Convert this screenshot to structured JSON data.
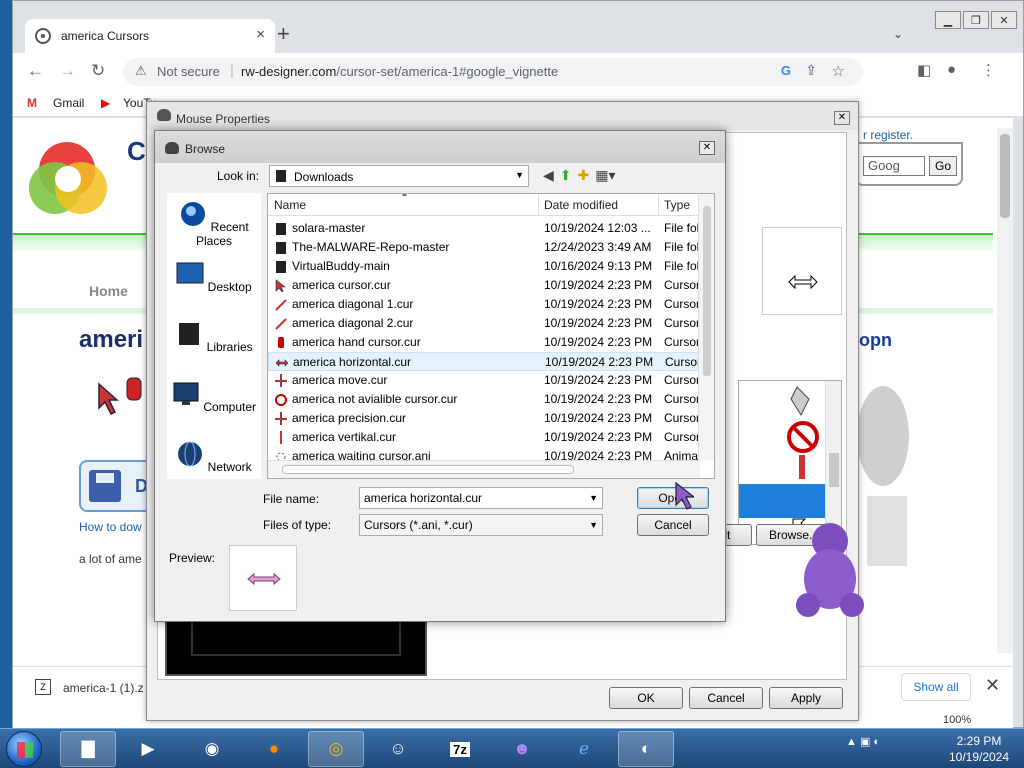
{
  "browser": {
    "tab_title": "america Cursors",
    "tab_close": "×",
    "new_tab": "+",
    "security": "Not secure",
    "url_host": "rw-designer.com",
    "url_path": "/cursor-set/america-1#google_vignette",
    "bookmarks": [
      "Gmail",
      "YouTu"
    ]
  },
  "webpage": {
    "site_initial": "C",
    "nav_home": "Home",
    "heading_partial": "ameri",
    "download_partial": "D",
    "howto_partial": "How to dow",
    "desc_partial": "a lot of ame",
    "register": "r register.",
    "search_placeholder": "Goog",
    "search_go": "Go",
    "right_partial": "opn",
    "download_file": "america-1 (1).z",
    "show_all": "Show all",
    "zoom": "100%"
  },
  "mouse_properties": {
    "title": "Mouse Properties",
    "use_default_partial": "ult",
    "browse_button": "Browse...",
    "ok": "OK",
    "cancel": "Cancel",
    "apply": "Apply"
  },
  "browse": {
    "title": "Browse",
    "look_in_label": "Look in:",
    "look_in_value": "Downloads",
    "places": [
      "Recent Places",
      "Desktop",
      "Libraries",
      "Computer",
      "Network"
    ],
    "columns": {
      "name": "Name",
      "date": "Date modified",
      "type": "Type"
    },
    "rows": [
      {
        "name": "solara-master",
        "date": "10/19/2024 12:03 ...",
        "type": "File fol"
      },
      {
        "name": "The-MALWARE-Repo-master",
        "date": "12/24/2023 3:49 AM",
        "type": "File fol"
      },
      {
        "name": "VirtualBuddy-main",
        "date": "10/16/2024 9:13 PM",
        "type": "File fol"
      },
      {
        "name": "america cursor.cur",
        "date": "10/19/2024 2:23 PM",
        "type": "Cursor"
      },
      {
        "name": "america diagonal 1.cur",
        "date": "10/19/2024 2:23 PM",
        "type": "Cursor"
      },
      {
        "name": "america diagonal 2.cur",
        "date": "10/19/2024 2:23 PM",
        "type": "Cursor"
      },
      {
        "name": "america hand cursor.cur",
        "date": "10/19/2024 2:23 PM",
        "type": "Cursor"
      },
      {
        "name": "america horizontal.cur",
        "date": "10/19/2024 2:23 PM",
        "type": "Cursor"
      },
      {
        "name": "america move.cur",
        "date": "10/19/2024 2:23 PM",
        "type": "Cursor"
      },
      {
        "name": "america not avialible cursor.cur",
        "date": "10/19/2024 2:23 PM",
        "type": "Cursor"
      },
      {
        "name": "america precision.cur",
        "date": "10/19/2024 2:23 PM",
        "type": "Cursor"
      },
      {
        "name": "america vertikal.cur",
        "date": "10/19/2024 2:23 PM",
        "type": "Cursor"
      },
      {
        "name": "america waiting cursor.ani",
        "date": "10/19/2024 2:23 PM",
        "type": "Animat"
      }
    ],
    "selected_index": 7,
    "file_name_label": "File name:",
    "file_name_value": "america horizontal.cur",
    "file_type_label": "Files of type:",
    "file_type_value": "Cursors (*.ani, *.cur)",
    "open": "Open",
    "cancel": "Cancel",
    "preview_label": "Preview:"
  },
  "taskbar": {
    "time": "2:29 PM",
    "date": "10/19/2024"
  },
  "colors": {
    "selection": "#1e7fdc",
    "link": "#1a5fb4",
    "taskbar": "#1d4777"
  }
}
